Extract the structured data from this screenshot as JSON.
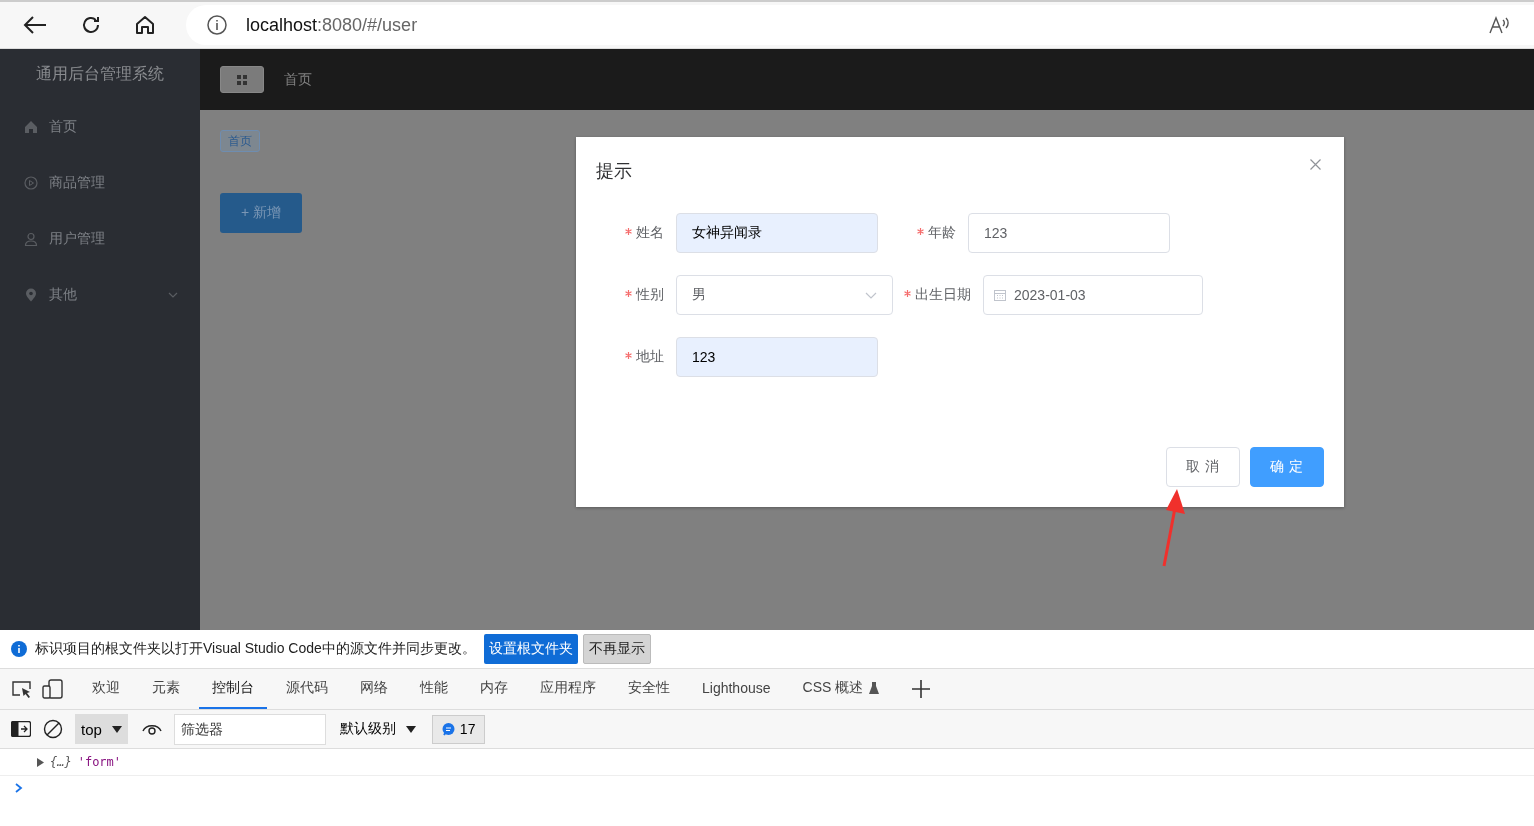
{
  "browser": {
    "url_host": "localhost",
    "url_path": ":8080/#/user"
  },
  "app": {
    "title": "通用后台管理系统",
    "menu": [
      {
        "label": "首页",
        "kind": "item"
      },
      {
        "label": "商品管理",
        "kind": "item"
      },
      {
        "label": "用户管理",
        "kind": "item"
      },
      {
        "label": "其他",
        "kind": "submenu"
      }
    ],
    "header": {
      "breadcrumb": "首页"
    },
    "tag": "首页",
    "add_button": "+ 新增"
  },
  "dialog": {
    "title": "提示",
    "rows": [
      [
        {
          "label": "姓名",
          "required": true,
          "kind": "input",
          "value": "女神异闻录",
          "autofilled": true
        },
        {
          "label": "年龄",
          "required": true,
          "kind": "input",
          "value": "123",
          "autofilled": false
        }
      ],
      [
        {
          "label": "性别",
          "required": true,
          "kind": "select",
          "value": "男",
          "autofilled": false
        },
        {
          "label": "出生日期",
          "required": true,
          "kind": "date",
          "value": "2023-01-03",
          "autofilled": false
        }
      ],
      [
        {
          "label": "地址",
          "required": true,
          "kind": "input",
          "value": "123",
          "autofilled": true
        }
      ]
    ],
    "buttons": [
      {
        "label": "取 消",
        "kind": "default"
      },
      {
        "label": "确 定",
        "kind": "primary"
      }
    ]
  },
  "devtools": {
    "notice": {
      "text": "标识项目的根文件夹以打开Visual Studio Code中的源文件并同步更改。",
      "buttons": [
        {
          "label": "设置根文件夹",
          "kind": "primary"
        },
        {
          "label": "不再显示",
          "kind": "default"
        }
      ]
    },
    "tabs": [
      {
        "label": "欢迎",
        "selected": false
      },
      {
        "label": "元素",
        "selected": false
      },
      {
        "label": "控制台",
        "selected": true
      },
      {
        "label": "源代码",
        "selected": false
      },
      {
        "label": "网络",
        "selected": false
      },
      {
        "label": "性能",
        "selected": false
      },
      {
        "label": "内存",
        "selected": false
      },
      {
        "label": "应用程序",
        "selected": false
      },
      {
        "label": "安全性",
        "selected": false
      },
      {
        "label": "Lighthouse",
        "selected": false
      },
      {
        "label": "CSS 概述",
        "selected": false,
        "experimental": true
      }
    ],
    "context": "top",
    "filter": {
      "placeholder": "筛选器"
    },
    "level": "默认级别",
    "message_count": "17",
    "console": [
      {
        "object": "{…}",
        "text": "'form'"
      }
    ]
  }
}
